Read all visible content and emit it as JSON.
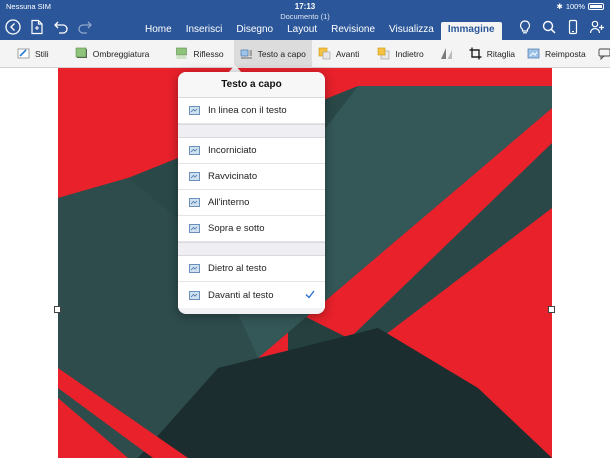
{
  "status_bar": {
    "carrier": "Nessuna SIM",
    "time": "17:13",
    "battery": "100%"
  },
  "app": {
    "document_title": "Documento (1)",
    "accent_color": "#2b579a"
  },
  "tabs": [
    {
      "label": "Home"
    },
    {
      "label": "Inserisci"
    },
    {
      "label": "Disegno"
    },
    {
      "label": "Layout"
    },
    {
      "label": "Revisione"
    },
    {
      "label": "Visualizza"
    },
    {
      "label": "Immagine",
      "active": true
    }
  ],
  "ribbon": {
    "stili": "Stili",
    "ombreggiatura": "Ombreggiatura",
    "riflesso": "Riflesso",
    "testo_a_capo": "Testo a capo",
    "avanti": "Avanti",
    "indietro": "Indietro",
    "ritaglia": "Ritaglia",
    "reimposta": "Reimposta"
  },
  "popover": {
    "title": "Testo a capo",
    "group1": [
      {
        "label": "In linea con il testo"
      }
    ],
    "group2": [
      {
        "label": "Incorniciato"
      },
      {
        "label": "Ravvicinato"
      },
      {
        "label": "All'interno"
      },
      {
        "label": "Sopra e sotto"
      }
    ],
    "group3": [
      {
        "label": "Dietro al testo"
      },
      {
        "label": "Davanti al testo",
        "selected": true
      }
    ]
  },
  "image_colors": {
    "red": "#e8212b",
    "dark_teal": "#2a4848",
    "mid_teal": "#345757",
    "darkest": "#1b2d2f"
  }
}
